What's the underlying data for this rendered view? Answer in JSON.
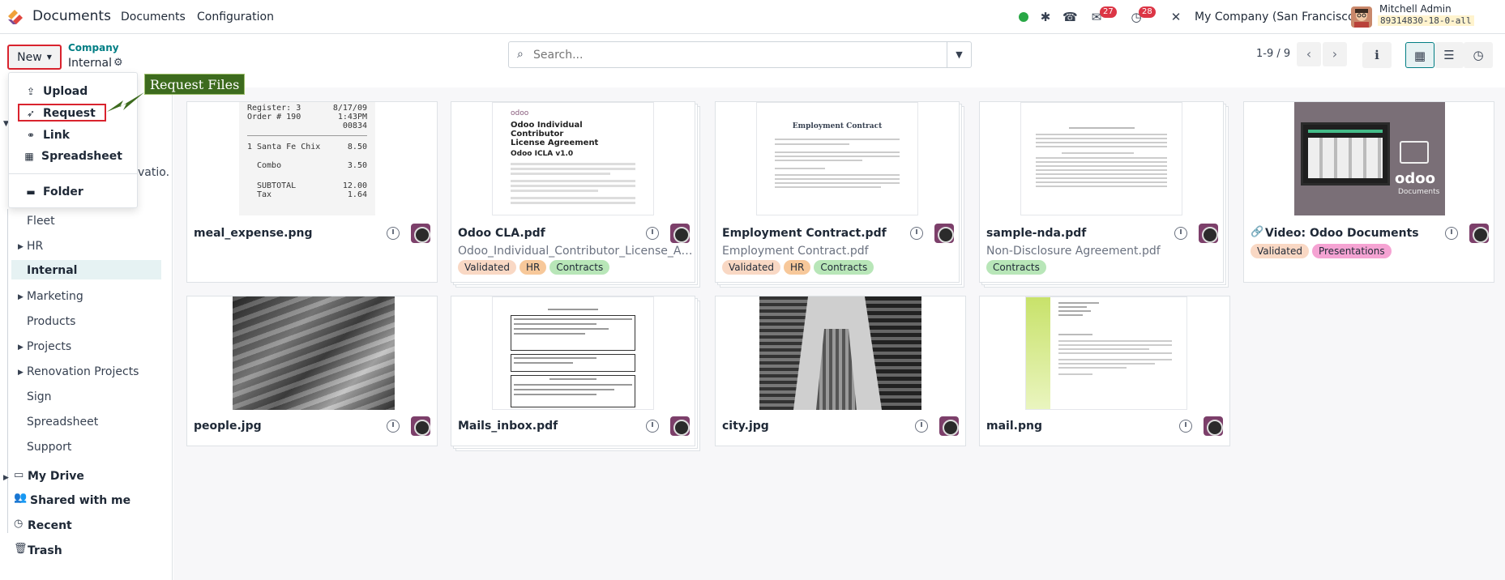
{
  "topbar": {
    "app_name": "Documents",
    "menu": [
      "Documents",
      "Configuration"
    ],
    "chat_badge": "27",
    "activity_badge": "28",
    "company": "My Company (San Francisco)",
    "user_name": "Mitchell Admin",
    "db_name": "89314830-18-0-all"
  },
  "control": {
    "new_label": "New",
    "breadcrumb_parent": "Company",
    "breadcrumb_current": "Internal",
    "search_placeholder": "Search...",
    "pager": "1-9 / 9"
  },
  "new_menu": {
    "items": [
      "Upload",
      "Request",
      "Link",
      "Spreadsheet",
      "Folder"
    ]
  },
  "callout": "Request Files",
  "sidebar": {
    "partial_text": "vatio.",
    "items": [
      "Fleet",
      "HR",
      "Internal",
      "Marketing",
      "Products",
      "Projects",
      "Renovation Projects",
      "Sign",
      "Spreadsheet",
      "Support"
    ],
    "bottom": [
      "My Drive",
      "Shared with me",
      "Recent",
      "Trash"
    ]
  },
  "cards": [
    {
      "title": "meal_expense.png",
      "subtitle": "",
      "tags": []
    },
    {
      "title": "Odoo CLA.pdf",
      "subtitle": "Odoo_Individual_Contributor_License_Agr...",
      "tags": [
        "Validated",
        "HR",
        "Contracts"
      ]
    },
    {
      "title": "Employment Contract.pdf",
      "subtitle": "Employment Contract.pdf",
      "tags": [
        "Validated",
        "HR",
        "Contracts"
      ]
    },
    {
      "title": "sample-nda.pdf",
      "subtitle": "Non-Disclosure Agreement.pdf",
      "tags": [
        "Contracts"
      ]
    },
    {
      "title": "Video: Odoo Documents",
      "subtitle": "",
      "tags": [
        "Validated",
        "Presentations"
      ]
    },
    {
      "title": "people.jpg",
      "subtitle": "",
      "tags": []
    },
    {
      "title": "Mails_inbox.pdf",
      "subtitle": "",
      "tags": []
    },
    {
      "title": "city.jpg",
      "subtitle": "",
      "tags": []
    },
    {
      "title": "mail.png",
      "subtitle": "",
      "tags": []
    }
  ],
  "thumbs": {
    "receipt": [
      "Register: 3",
      "8/17/09",
      "Order # 190",
      "1:43PM",
      "00834",
      "1 Santa Fe Chix",
      "8.50",
      "Combo",
      "3.50",
      "SUBTOTAL",
      "12.00",
      "Tax",
      "1.64"
    ],
    "cla": [
      "odoo",
      "Odoo Individual Contributor",
      "License Agreement",
      "Odoo ICLA v1.0"
    ],
    "employment": "Employment Contract",
    "video_logo": "odoo",
    "video_caption": "Documents"
  },
  "colors": {
    "accent": "#017e84",
    "tag_validated": "#f9d8c4",
    "tag_hr": "#f7c89a",
    "tag_contracts": "#b8e6b8",
    "tag_presentations": "#f5a3d3",
    "highlight_red": "#d9232e",
    "callout_green": "#3d6b1e"
  }
}
